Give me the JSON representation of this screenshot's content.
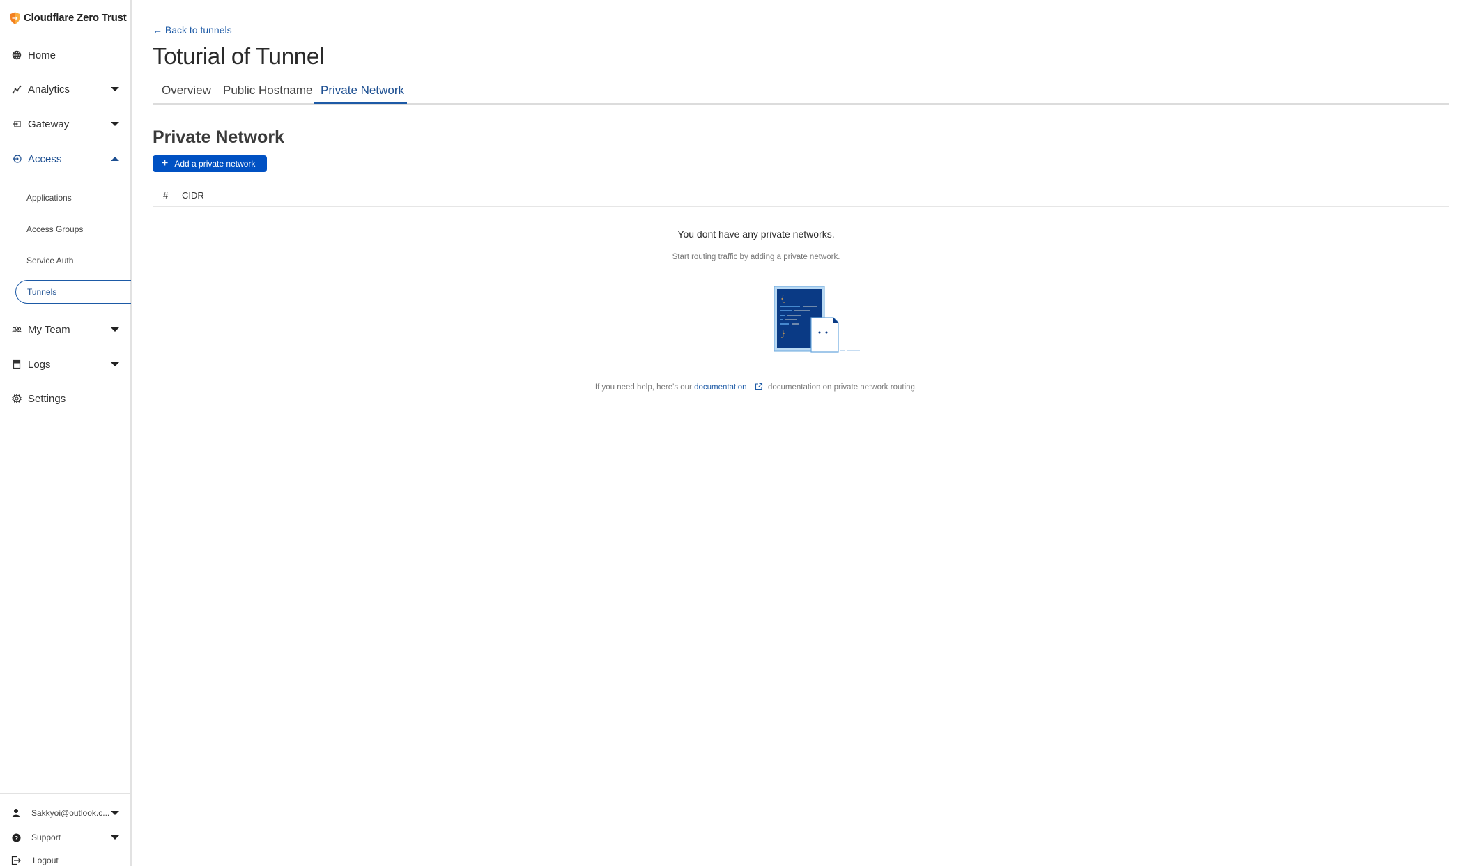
{
  "brand": {
    "name": "Cloudflare Zero Trust",
    "logo_color": "#f38020"
  },
  "sidebar": {
    "items": [
      {
        "label": "Home",
        "icon": "globe-icon",
        "expandable": false
      },
      {
        "label": "Analytics",
        "icon": "analytics-icon",
        "expandable": true,
        "expanded": false
      },
      {
        "label": "Gateway",
        "icon": "gateway-icon",
        "expandable": true,
        "expanded": false
      },
      {
        "label": "Access",
        "icon": "access-icon",
        "expandable": true,
        "expanded": true
      },
      {
        "label": "My Team",
        "icon": "team-icon",
        "expandable": true,
        "expanded": false
      },
      {
        "label": "Logs",
        "icon": "logs-icon",
        "expandable": true,
        "expanded": false
      },
      {
        "label": "Settings",
        "icon": "gear-icon",
        "expandable": false
      }
    ],
    "access_subitems": [
      {
        "label": "Applications",
        "active": false
      },
      {
        "label": "Access Groups",
        "active": false
      },
      {
        "label": "Service Auth",
        "active": false
      },
      {
        "label": "Tunnels",
        "active": true
      }
    ],
    "bottom": {
      "account": "Sakkyoi@outlook.c...",
      "support": "Support",
      "logout": "Logout"
    }
  },
  "main": {
    "back_link": "← Back to tunnels",
    "title": "Toturial of Tunnel",
    "tabs": [
      {
        "label": "Overview",
        "active": false
      },
      {
        "label": "Public Hostname",
        "active": false
      },
      {
        "label": "Private Network",
        "active": true
      }
    ],
    "section_title": "Private Network",
    "add_button": {
      "icon": "+",
      "label": "Add a private network"
    },
    "table": {
      "columns": [
        "#",
        "CIDR"
      ],
      "rows": []
    },
    "empty_state": {
      "title": "You dont have any private networks.",
      "subtitle": "Start routing traffic by adding a private network.",
      "help_prefix": "If you need help, here's our",
      "help_link": "documentation",
      "help_suffix": "documentation on private network routing."
    }
  },
  "colors": {
    "accent": "#0051c3",
    "active_text": "#1d4f91",
    "link": "#1d5aa6"
  }
}
